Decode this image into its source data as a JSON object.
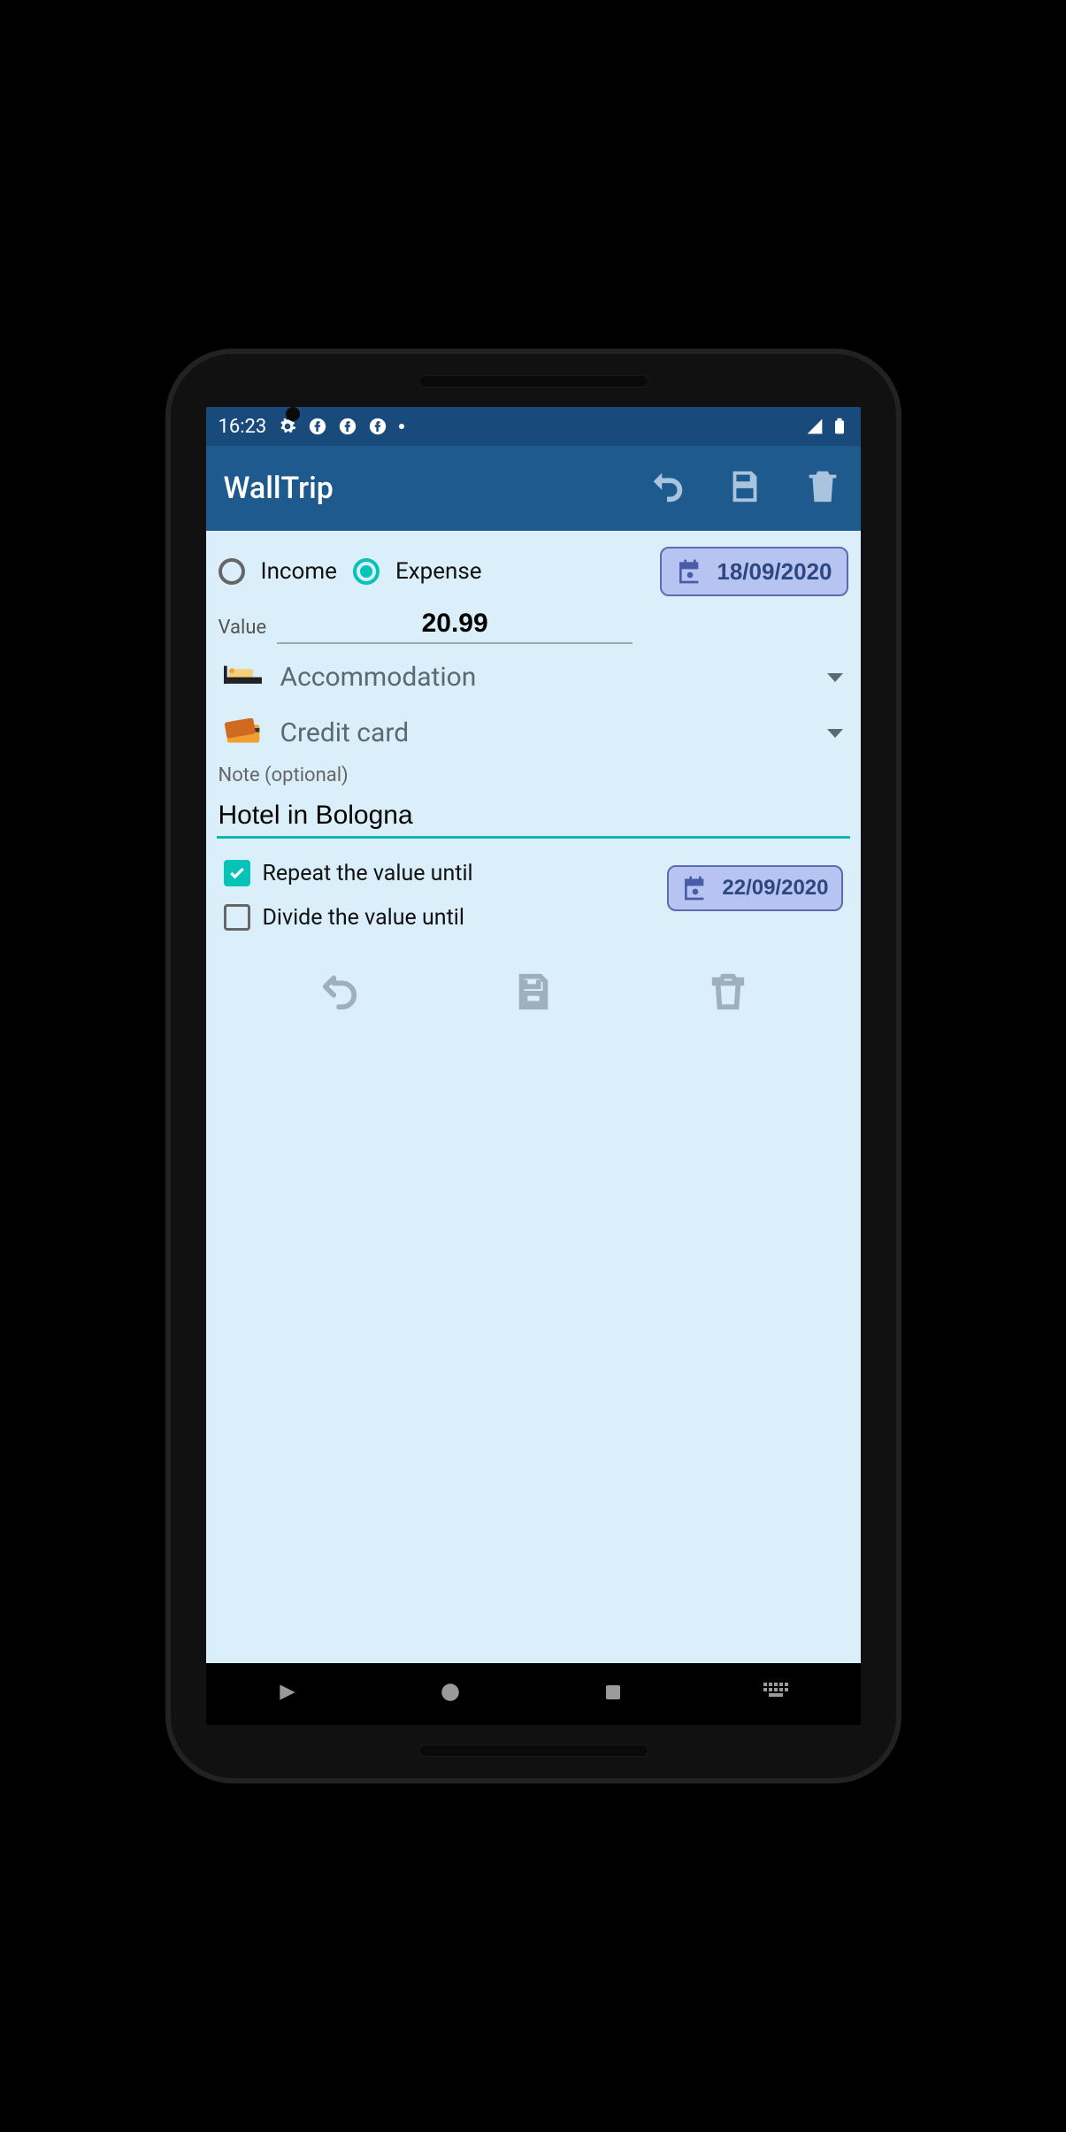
{
  "statusbar": {
    "time": "16:23"
  },
  "appbar": {
    "title": "WallTrip"
  },
  "type": {
    "income_label": "Income",
    "expense_label": "Expense",
    "selected": "expense"
  },
  "date_main": "18/09/2020",
  "value_label": "Value",
  "value": "20.99",
  "category": {
    "label": "Accommodation"
  },
  "payment": {
    "label": "Credit card"
  },
  "note_label": "Note (optional)",
  "note_value": "Hotel in Bologna",
  "repeat": {
    "label": "Repeat the value until",
    "checked": true
  },
  "divide": {
    "label": "Divide the value until",
    "checked": false
  },
  "date_until": "22/09/2020"
}
